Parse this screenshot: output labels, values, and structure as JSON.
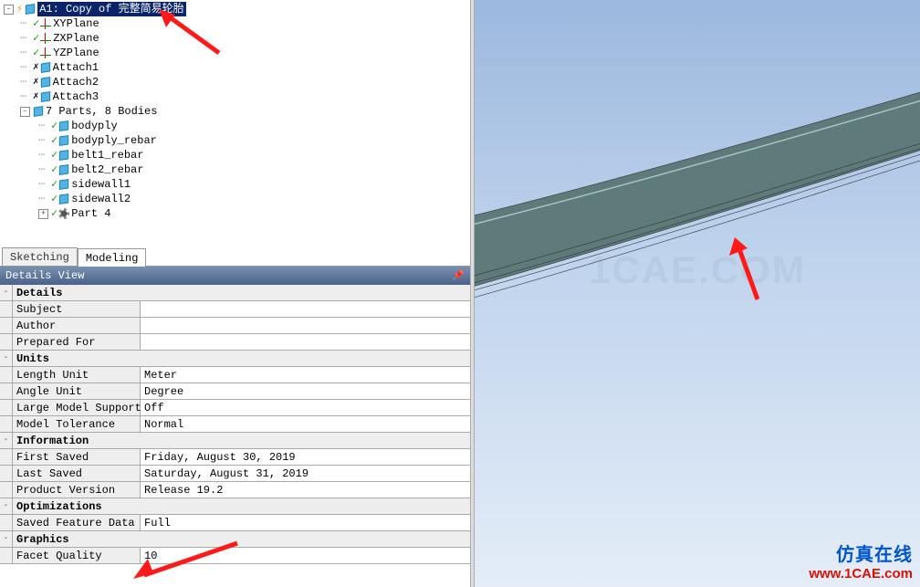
{
  "tree": {
    "root": {
      "label": "A1: Copy of 完整简易轮胎"
    },
    "planes": [
      "XYPlane",
      "ZXPlane",
      "YZPlane"
    ],
    "attaches": [
      "Attach1",
      "Attach2",
      "Attach3"
    ],
    "partsHeader": "7 Parts, 8 Bodies",
    "bodies": [
      "bodyply",
      "bodyply_rebar",
      "belt1_rebar",
      "belt2_rebar",
      "sidewall1",
      "sidewall2"
    ],
    "partLast": "Part 4"
  },
  "tabs": {
    "sketching": "Sketching",
    "modeling": "Modeling"
  },
  "detailsTitle": "Details View",
  "grid": {
    "headers": {
      "details": "Details",
      "units": "Units",
      "information": "Information",
      "optimizations": "Optimizations",
      "graphics": "Graphics"
    },
    "rows": {
      "subject": {
        "label": "Subject",
        "value": ""
      },
      "author": {
        "label": "Author",
        "value": ""
      },
      "preparedFor": {
        "label": "Prepared For",
        "value": ""
      },
      "lengthUnit": {
        "label": "Length Unit",
        "value": "Meter"
      },
      "angleUnit": {
        "label": "Angle Unit",
        "value": "Degree"
      },
      "largeModel": {
        "label": "Large Model Support",
        "value": "Off"
      },
      "modelTol": {
        "label": "Model Tolerance",
        "value": "Normal"
      },
      "firstSaved": {
        "label": "First Saved",
        "value": "Friday, August 30, 2019"
      },
      "lastSaved": {
        "label": "Last Saved",
        "value": "Saturday, August 31, 2019"
      },
      "productVer": {
        "label": "Product Version",
        "value": "Release 19.2"
      },
      "savedFeat": {
        "label": "Saved Feature Data",
        "value": "Full"
      },
      "facetQ": {
        "label": "Facet Quality",
        "value": "10"
      }
    }
  },
  "watermark": {
    "faded": "1CAE.COM",
    "cn": "仿真在线",
    "en": "www.1CAE.com"
  }
}
